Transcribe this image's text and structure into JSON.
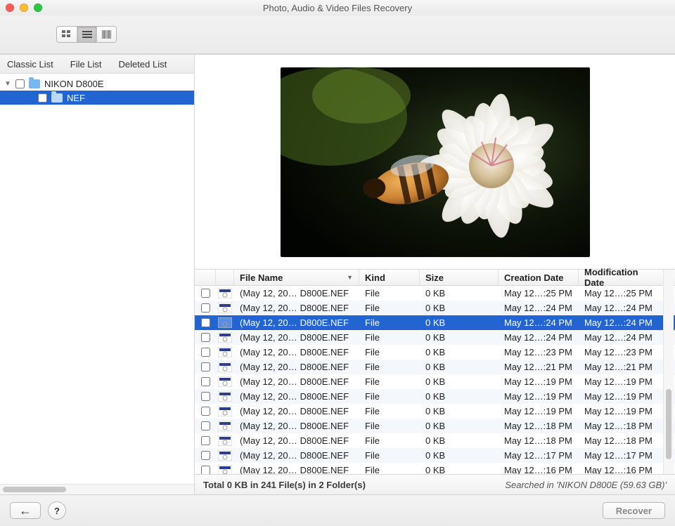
{
  "title": "Photo, Audio & Video Files Recovery",
  "sidebar": {
    "tabs": [
      "Classic List",
      "File List",
      "Deleted List"
    ],
    "tree": [
      {
        "label": "NIKON D800E",
        "level": 0,
        "expanded": true,
        "selected": false
      },
      {
        "label": "NEF",
        "level": 1,
        "expanded": false,
        "selected": true
      }
    ]
  },
  "table": {
    "columns": {
      "file_name": "File Name",
      "kind": "Kind",
      "size": "Size",
      "creation": "Creation Date",
      "modification": "Modification Date"
    },
    "rows": [
      {
        "selected": false,
        "name_a": "(May 12, 20…",
        "name_b": "D800E.NEF",
        "kind": "File",
        "size": "0 KB",
        "cdate": "May 12…:25 PM",
        "mdate": "May 12…:25 PM"
      },
      {
        "selected": false,
        "name_a": "(May 12, 20…",
        "name_b": "D800E.NEF",
        "kind": "File",
        "size": "0 KB",
        "cdate": "May 12…:24 PM",
        "mdate": "May 12…:24 PM"
      },
      {
        "selected": true,
        "name_a": "(May 12, 20…",
        "name_b": "D800E.NEF",
        "kind": "File",
        "size": "0 KB",
        "cdate": "May 12…:24 PM",
        "mdate": "May 12…:24 PM"
      },
      {
        "selected": false,
        "name_a": "(May 12, 20…",
        "name_b": "D800E.NEF",
        "kind": "File",
        "size": "0 KB",
        "cdate": "May 12…:24 PM",
        "mdate": "May 12…:24 PM"
      },
      {
        "selected": false,
        "name_a": "(May 12, 20…",
        "name_b": "D800E.NEF",
        "kind": "File",
        "size": "0 KB",
        "cdate": "May 12…:23 PM",
        "mdate": "May 12…:23 PM"
      },
      {
        "selected": false,
        "name_a": "(May 12, 20…",
        "name_b": "D800E.NEF",
        "kind": "File",
        "size": "0 KB",
        "cdate": "May 12…:21 PM",
        "mdate": "May 12…:21 PM"
      },
      {
        "selected": false,
        "name_a": "(May 12, 20…",
        "name_b": "D800E.NEF",
        "kind": "File",
        "size": "0 KB",
        "cdate": "May 12…:19 PM",
        "mdate": "May 12…:19 PM"
      },
      {
        "selected": false,
        "name_a": "(May 12, 20…",
        "name_b": "D800E.NEF",
        "kind": "File",
        "size": "0 KB",
        "cdate": "May 12…:19 PM",
        "mdate": "May 12…:19 PM"
      },
      {
        "selected": false,
        "name_a": "(May 12, 20…",
        "name_b": "D800E.NEF",
        "kind": "File",
        "size": "0 KB",
        "cdate": "May 12…:19 PM",
        "mdate": "May 12…:19 PM"
      },
      {
        "selected": false,
        "name_a": "(May 12, 20…",
        "name_b": "D800E.NEF",
        "kind": "File",
        "size": "0 KB",
        "cdate": "May 12…:18 PM",
        "mdate": "May 12…:18 PM"
      },
      {
        "selected": false,
        "name_a": "(May 12, 20…",
        "name_b": "D800E.NEF",
        "kind": "File",
        "size": "0 KB",
        "cdate": "May 12…:18 PM",
        "mdate": "May 12…:18 PM"
      },
      {
        "selected": false,
        "name_a": "(May 12, 20…",
        "name_b": "D800E.NEF",
        "kind": "File",
        "size": "0 KB",
        "cdate": "May 12…:17 PM",
        "mdate": "May 12…:17 PM"
      },
      {
        "selected": false,
        "name_a": "(May 12, 20…",
        "name_b": "D800E.NEF",
        "kind": "File",
        "size": "0 KB",
        "cdate": "May 12…:16 PM",
        "mdate": "May 12…:16 PM"
      }
    ]
  },
  "status": {
    "summary": "Total 0 KB in 241 File(s) in 2 Folder(s)",
    "searched": "Searched in 'NIKON D800E (59.63 GB)'"
  },
  "footer": {
    "back_glyph": "←",
    "help_glyph": "?",
    "recover_label": "Recover"
  }
}
